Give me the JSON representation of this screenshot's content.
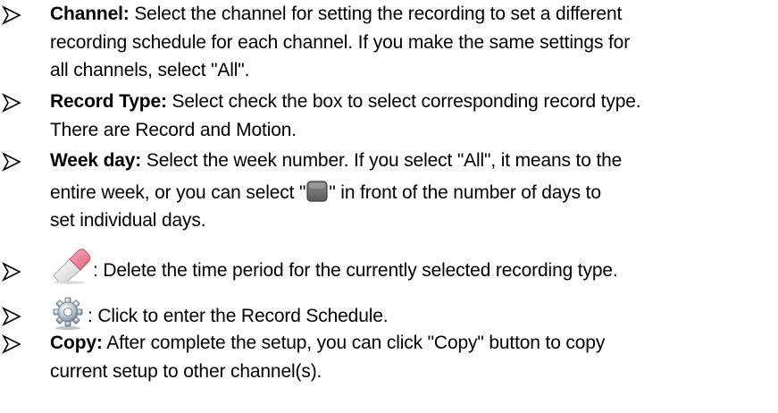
{
  "bullet_icon": "right-arrowhead-bullet",
  "items": [
    {
      "label": "Channel:",
      "text": "Select the channel for setting the recording to set a different",
      "text2": "recording schedule for each channel. If you make the same settings for",
      "text3": "all channels, select \"All\"."
    },
    {
      "label": "Record Type:",
      "text": "Select check the box to select corresponding record type.",
      "text2": "There are Record and Motion."
    },
    {
      "label": "Week day:",
      "text": "Select the week number. If you select \"All\", it means to the",
      "text2a": "entire week, or you can select \"",
      "text2b": "\" in front of the number of days to",
      "text3": "set individual days.",
      "checkbox_icon": "checkbox-icon"
    },
    {
      "icon": "eraser-icon",
      "text": ": Delete the time period for the currently selected recording type."
    },
    {
      "icon": "gear-icon",
      "text": ": Click to enter the Record Schedule."
    },
    {
      "label": "Copy:",
      "text": "After complete the setup, you can click \"Copy\" button to copy",
      "text2": "current setup to other channel(s)."
    }
  ]
}
